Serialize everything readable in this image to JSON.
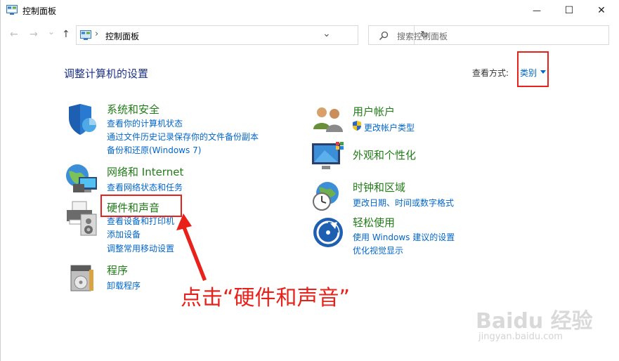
{
  "window": {
    "title": "控制面板",
    "minimize_glyph": "—",
    "maximize_glyph": "☐",
    "close_glyph": "✕"
  },
  "nav": {
    "back_glyph": "←",
    "forward_glyph": "→",
    "recent_glyph": "⌄",
    "up_glyph": "↑"
  },
  "address": {
    "separator": "›",
    "path": "控制面板",
    "dropdown_glyph": "⌄",
    "refresh_glyph": "↻"
  },
  "search": {
    "placeholder": "搜索控制面板"
  },
  "heading": "调整计算机的设置",
  "view_by": {
    "label": "查看方式:",
    "value": "类别"
  },
  "categories_left": [
    {
      "title": "系统和安全",
      "links": [
        "查看你的计算机状态",
        "通过文件历史记录保存你的文件备份副本",
        "备份和还原(Windows 7)"
      ]
    },
    {
      "title": "网络和 Internet",
      "links": [
        "查看网络状态和任务"
      ]
    },
    {
      "title": "硬件和声音",
      "links": [
        "查看设备和打印机",
        "添加设备",
        "调整常用移动设置"
      ]
    },
    {
      "title": "程序",
      "links": [
        "卸载程序"
      ]
    }
  ],
  "categories_right": [
    {
      "title": "用户帐户",
      "links": [
        "更改帐户类型"
      ]
    },
    {
      "title": "外观和个性化",
      "links": []
    },
    {
      "title": "时钟和区域",
      "links": [
        "更改日期、时间或数字格式"
      ]
    },
    {
      "title": "轻松使用",
      "links": [
        "使用 Windows 建议的设置",
        "优化视觉显示"
      ]
    }
  ],
  "annotation": "点击“硬件和声音”",
  "watermark": {
    "brand": "Baidu 经验",
    "url": "jingyan.baidu.com"
  },
  "colors": {
    "accent_red": "#e8211b",
    "link_blue": "#0066cc",
    "category_green": "#207c16",
    "heading_navy": "#1e3287"
  }
}
